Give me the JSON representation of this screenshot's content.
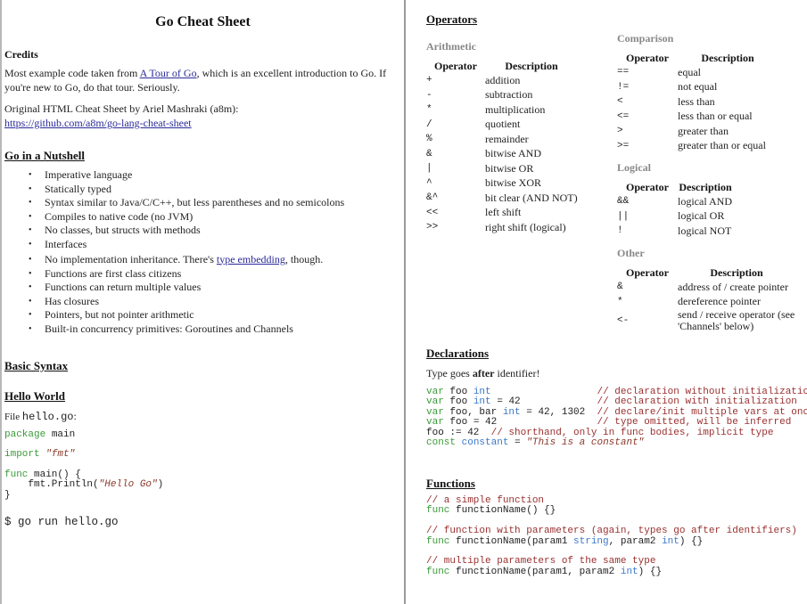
{
  "left": {
    "title": "Go Cheat Sheet",
    "credits": {
      "heading": "Credits",
      "p1_before": "Most example code taken from ",
      "p1_link": "A Tour of Go",
      "p1_after_line1": ", which is an excellent introduction to Go. If",
      "p1_line2": "you're new to Go, do that tour. Seriously.",
      "p2_line1": "Original HTML Cheat Sheet by Ariel Mashraki (a8m):",
      "p2_link": "https://github.com/a8m/go-lang-cheat-sheet"
    },
    "nutshell": {
      "heading": "Go in a Nutshell",
      "items": [
        "Imperative language",
        "Statically typed",
        "Syntax similar to Java/C/C++, but less parentheses and no semicolons",
        "Compiles to native code (no JVM)",
        "No classes, but structs with methods",
        "Interfaces",
        "No implementation inheritance. There's ",
        "Functions are first class citizens",
        "Functions can return multiple values",
        "Has closures",
        "Pointers, but not pointer arithmetic",
        "Built-in concurrency primitives: Goroutines and Channels"
      ],
      "item7_link": "type embedding",
      "item7_after": ", though."
    },
    "basic_syntax": {
      "heading": "Basic Syntax"
    },
    "hello_world": {
      "heading": "Hello World",
      "file_label": "File ",
      "file_name": "hello.go",
      "file_colon": ":",
      "code": {
        "package_kw": "package",
        "package_name": " main",
        "import_kw": "import",
        "import_str": "\"fmt\"",
        "func_kw": "func",
        "func_sig": " main() {",
        "println_before": "    fmt.Println(",
        "println_str": "\"Hello Go\"",
        "println_after": ")",
        "close": "}"
      },
      "run_cmd": "$ go run hello.go"
    }
  },
  "right": {
    "operators": {
      "heading": "Operators",
      "arithmetic": {
        "title": "Arithmetic",
        "headers": [
          "Operator",
          "Description"
        ],
        "rows": [
          [
            "+",
            "addition"
          ],
          [
            "-",
            "subtraction"
          ],
          [
            "*",
            "multiplication"
          ],
          [
            "/",
            "quotient"
          ],
          [
            "%",
            "remainder"
          ],
          [
            "&",
            "bitwise AND"
          ],
          [
            "|",
            "bitwise OR"
          ],
          [
            "^",
            "bitwise XOR"
          ],
          [
            "&^",
            "bit clear (AND NOT)"
          ],
          [
            "<<",
            "left shift"
          ],
          [
            ">>",
            "right shift (logical)"
          ]
        ]
      },
      "comparison": {
        "title": "Comparison",
        "headers": [
          "Operator",
          "Description"
        ],
        "rows": [
          [
            "==",
            "equal"
          ],
          [
            "!=",
            "not equal"
          ],
          [
            "<",
            "less than"
          ],
          [
            "<=",
            "less than or equal"
          ],
          [
            ">",
            "greater than"
          ],
          [
            ">=",
            "greater than or equal"
          ]
        ]
      },
      "logical": {
        "title": "Logical",
        "headers": [
          "Operator",
          "Description"
        ],
        "rows": [
          [
            "&&",
            "logical AND"
          ],
          [
            "||",
            "logical OR"
          ],
          [
            "!",
            "logical NOT"
          ]
        ]
      },
      "other": {
        "title": "Other",
        "headers": [
          "Operator",
          "Description"
        ],
        "rows": [
          [
            "&",
            "address of / create pointer"
          ],
          [
            "*",
            "dereference pointer"
          ],
          [
            "<-",
            "send / receive operator (see 'Channels' below)"
          ]
        ]
      }
    },
    "declarations": {
      "heading": "Declarations",
      "intro_before": "Type goes ",
      "intro_bold": "after",
      "intro_after": " identifier!",
      "lines": [
        [
          {
            "t": "var",
            "c": "kw"
          },
          {
            "t": " foo ",
            "c": ""
          },
          {
            "t": "int",
            "c": "ty"
          },
          {
            "t": "                  ",
            "c": ""
          },
          {
            "t": "// declaration without initialization",
            "c": "cm"
          }
        ],
        [
          {
            "t": "var",
            "c": "kw"
          },
          {
            "t": " foo ",
            "c": ""
          },
          {
            "t": "int",
            "c": "ty"
          },
          {
            "t": " = 42             ",
            "c": ""
          },
          {
            "t": "// declaration with initialization",
            "c": "cm"
          }
        ],
        [
          {
            "t": "var",
            "c": "kw"
          },
          {
            "t": " foo, bar ",
            "c": ""
          },
          {
            "t": "int",
            "c": "ty"
          },
          {
            "t": " = 42, 1302  ",
            "c": ""
          },
          {
            "t": "// declare/init multiple vars at once",
            "c": "cm"
          }
        ],
        [
          {
            "t": "var",
            "c": "kw"
          },
          {
            "t": " foo = 42                 ",
            "c": ""
          },
          {
            "t": "// type omitted, will be inferred",
            "c": "cm"
          }
        ],
        [
          {
            "t": "foo := 42  ",
            "c": ""
          },
          {
            "t": "// shorthand, only in func bodies, implicit type",
            "c": "cm"
          }
        ],
        [
          {
            "t": "const",
            "c": "kw"
          },
          {
            "t": " ",
            "c": ""
          },
          {
            "t": "constant",
            "c": "ty"
          },
          {
            "t": " = ",
            "c": ""
          },
          {
            "t": "\"This is a constant\"",
            "c": "str"
          }
        ]
      ]
    },
    "functions": {
      "heading": "Functions",
      "lines": [
        [
          {
            "t": "// a simple function",
            "c": "cm"
          }
        ],
        [
          {
            "t": "func",
            "c": "kw"
          },
          {
            "t": " functionName() {}",
            "c": ""
          }
        ],
        [],
        [
          {
            "t": "// function with parameters (again, types go after identifiers)",
            "c": "cm"
          }
        ],
        [
          {
            "t": "func",
            "c": "kw"
          },
          {
            "t": " functionName(param1 ",
            "c": ""
          },
          {
            "t": "string",
            "c": "ty"
          },
          {
            "t": ", param2 ",
            "c": ""
          },
          {
            "t": "int",
            "c": "ty"
          },
          {
            "t": ") {}",
            "c": ""
          }
        ],
        [],
        [
          {
            "t": "// multiple parameters of the same type",
            "c": "cm"
          }
        ],
        [
          {
            "t": "func",
            "c": "kw"
          },
          {
            "t": " functionName(param1, param2 ",
            "c": ""
          },
          {
            "t": "int",
            "c": "ty"
          },
          {
            "t": ") {}",
            "c": ""
          }
        ]
      ]
    }
  }
}
